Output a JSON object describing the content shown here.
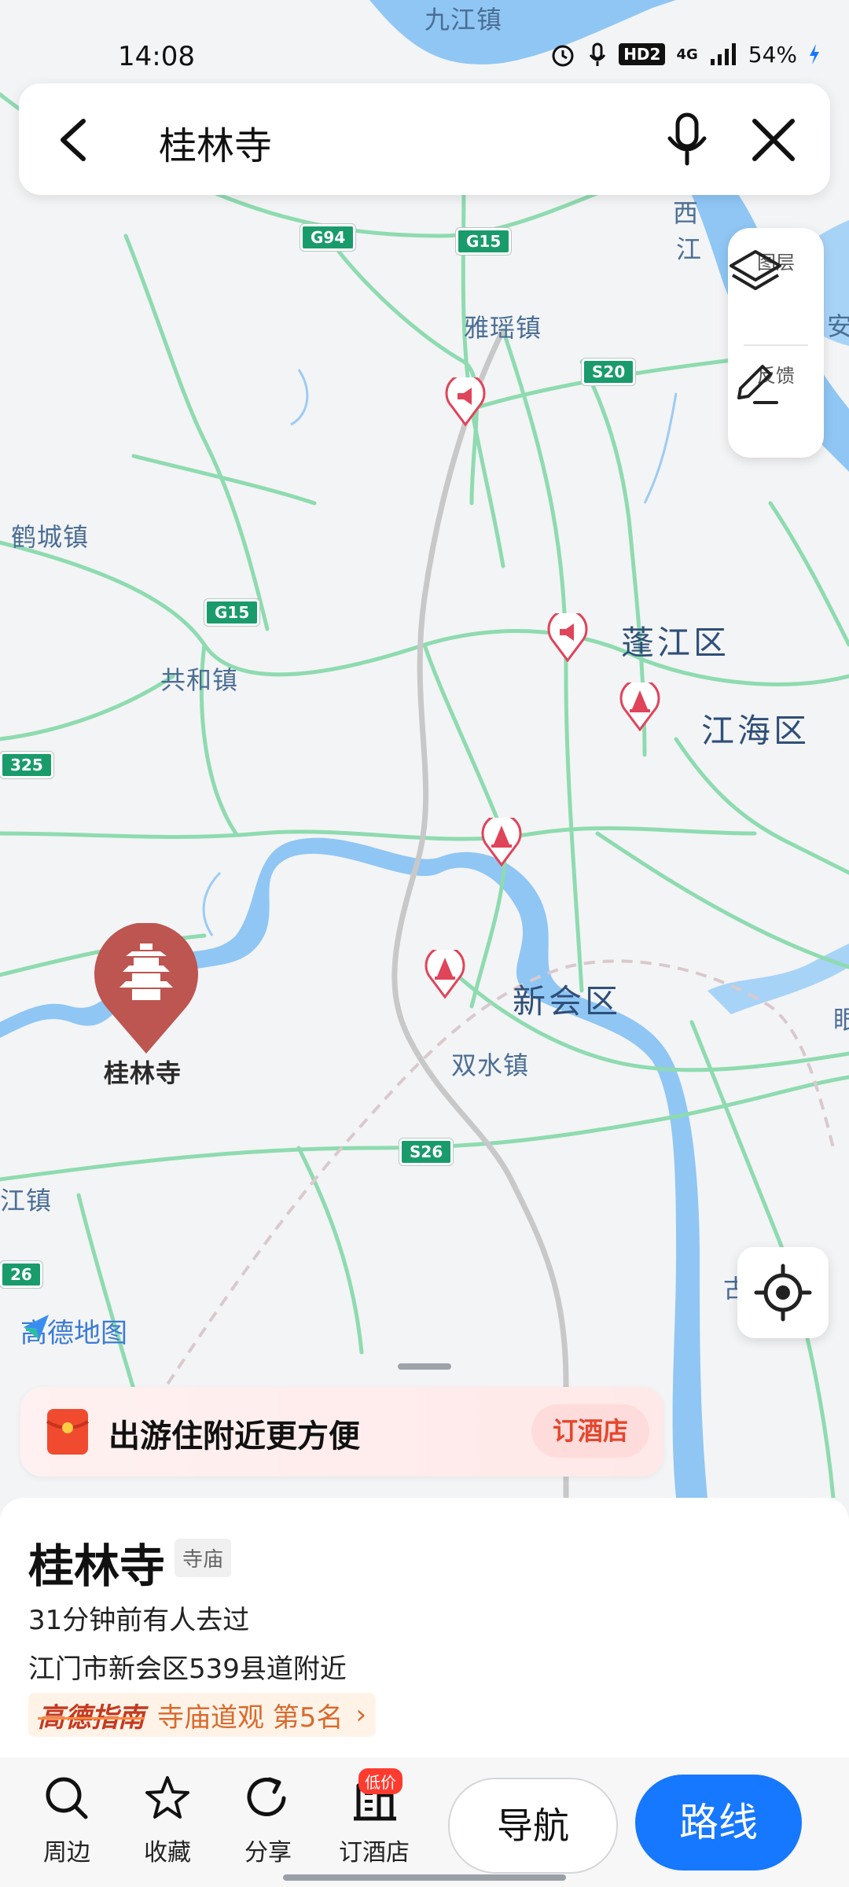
{
  "status_bar": {
    "time": "14:08",
    "network": "4G",
    "hd": "HD2",
    "battery": "54%"
  },
  "search": {
    "query": "桂林寺",
    "back_icon": "back-arrow-icon",
    "mic_icon": "microphone-icon",
    "close_icon": "close-icon"
  },
  "side_panel": {
    "layers_label": "图层",
    "feedback_label": "反馈"
  },
  "map": {
    "place_labels": [
      "九江镇",
      "雅瑶镇",
      "鹤城镇",
      "共和镇",
      "双水镇",
      "江镇",
      "西",
      "江",
      "安",
      "古",
      "眼"
    ],
    "district_labels": [
      "蓬江区",
      "江海区",
      "新会区"
    ],
    "road_shields": [
      "G94",
      "G15",
      "G15",
      "S20",
      "S26",
      "325",
      "26"
    ],
    "marker_label": "桂林寺",
    "brand": "高德地图"
  },
  "promo": {
    "text": "出游住附近更方便",
    "button": "订酒店"
  },
  "place": {
    "name": "桂林寺",
    "type": "寺庙",
    "visited": "31分钟前有人去过",
    "address": "江门市新会区539县道附近",
    "guide_brand": "高德指南",
    "guide_rank": "寺庙道观 第5名"
  },
  "bottom_bar": {
    "tabs": [
      {
        "label": "周边",
        "icon": "search-icon"
      },
      {
        "label": "收藏",
        "icon": "star-icon"
      },
      {
        "label": "分享",
        "icon": "share-icon"
      },
      {
        "label": "订酒店",
        "icon": "hotel-icon",
        "badge": "低价"
      }
    ],
    "navigate": "导航",
    "route": "路线"
  },
  "colors": {
    "accent": "#1677ff",
    "road": "#7fd7a3",
    "river": "#90c8f5",
    "marker": "#c0524d",
    "promo_accent": "#e5462c"
  }
}
